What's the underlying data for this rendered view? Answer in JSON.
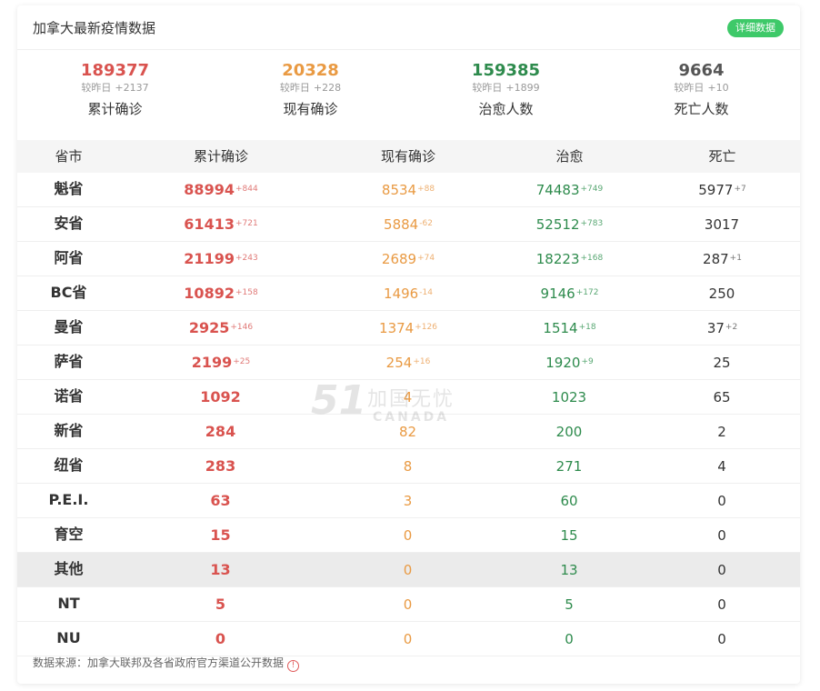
{
  "header": {
    "title": "加拿大最新疫情数据",
    "detail_button": "详细数据"
  },
  "summary": {
    "delta_prefix": "较昨日",
    "items": [
      {
        "value": "189377",
        "delta": "+2137",
        "label": "累计确诊",
        "color": "#d9534f"
      },
      {
        "value": "20328",
        "delta": "+228",
        "label": "现有确诊",
        "color": "#e99a43"
      },
      {
        "value": "159385",
        "delta": "+1899",
        "label": "治愈人数",
        "color": "#2e8b4d"
      },
      {
        "value": "9664",
        "delta": "+10",
        "label": "死亡人数",
        "color": "#555555"
      }
    ]
  },
  "table": {
    "headers": [
      "省市",
      "累计确诊",
      "现有确诊",
      "治愈",
      "死亡"
    ],
    "rows": [
      {
        "region": "魁省",
        "confirmed": "88994",
        "confirmed_delta": "+844",
        "current": "8534",
        "current_delta": "+88",
        "cured": "74483",
        "cured_delta": "+749",
        "dead": "5977",
        "dead_delta": "+7"
      },
      {
        "region": "安省",
        "confirmed": "61413",
        "confirmed_delta": "+721",
        "current": "5884",
        "current_delta": "-62",
        "cured": "52512",
        "cured_delta": "+783",
        "dead": "3017",
        "dead_delta": ""
      },
      {
        "region": "阿省",
        "confirmed": "21199",
        "confirmed_delta": "+243",
        "current": "2689",
        "current_delta": "+74",
        "cured": "18223",
        "cured_delta": "+168",
        "dead": "287",
        "dead_delta": "+1"
      },
      {
        "region": "BC省",
        "confirmed": "10892",
        "confirmed_delta": "+158",
        "current": "1496",
        "current_delta": "-14",
        "cured": "9146",
        "cured_delta": "+172",
        "dead": "250",
        "dead_delta": ""
      },
      {
        "region": "曼省",
        "confirmed": "2925",
        "confirmed_delta": "+146",
        "current": "1374",
        "current_delta": "+126",
        "cured": "1514",
        "cured_delta": "+18",
        "dead": "37",
        "dead_delta": "+2"
      },
      {
        "region": "萨省",
        "confirmed": "2199",
        "confirmed_delta": "+25",
        "current": "254",
        "current_delta": "+16",
        "cured": "1920",
        "cured_delta": "+9",
        "dead": "25",
        "dead_delta": ""
      },
      {
        "region": "诺省",
        "confirmed": "1092",
        "confirmed_delta": "",
        "current": "4",
        "current_delta": "",
        "cured": "1023",
        "cured_delta": "",
        "dead": "65",
        "dead_delta": ""
      },
      {
        "region": "新省",
        "confirmed": "284",
        "confirmed_delta": "",
        "current": "82",
        "current_delta": "",
        "cured": "200",
        "cured_delta": "",
        "dead": "2",
        "dead_delta": ""
      },
      {
        "region": "纽省",
        "confirmed": "283",
        "confirmed_delta": "",
        "current": "8",
        "current_delta": "",
        "cured": "271",
        "cured_delta": "",
        "dead": "4",
        "dead_delta": ""
      },
      {
        "region": "P.E.I.",
        "confirmed": "63",
        "confirmed_delta": "",
        "current": "3",
        "current_delta": "",
        "cured": "60",
        "cured_delta": "",
        "dead": "0",
        "dead_delta": ""
      },
      {
        "region": "育空",
        "confirmed": "15",
        "confirmed_delta": "",
        "current": "0",
        "current_delta": "",
        "cured": "15",
        "cured_delta": "",
        "dead": "0",
        "dead_delta": ""
      },
      {
        "region": "其他",
        "confirmed": "13",
        "confirmed_delta": "",
        "current": "0",
        "current_delta": "",
        "cured": "13",
        "cured_delta": "",
        "dead": "0",
        "dead_delta": "",
        "highlighted": true
      },
      {
        "region": "NT",
        "confirmed": "5",
        "confirmed_delta": "",
        "current": "0",
        "current_delta": "",
        "cured": "5",
        "cured_delta": "",
        "dead": "0",
        "dead_delta": ""
      },
      {
        "region": "NU",
        "confirmed": "0",
        "confirmed_delta": "",
        "current": "0",
        "current_delta": "",
        "cured": "0",
        "cured_delta": "",
        "dead": "0",
        "dead_delta": ""
      }
    ]
  },
  "watermark": {
    "number": "51",
    "cn": "加国无忧",
    "en": "CANADA"
  },
  "footer": {
    "source": "数据来源：加拿大联邦及各省政府官方渠道公开数据",
    "icon": "info-icon"
  }
}
